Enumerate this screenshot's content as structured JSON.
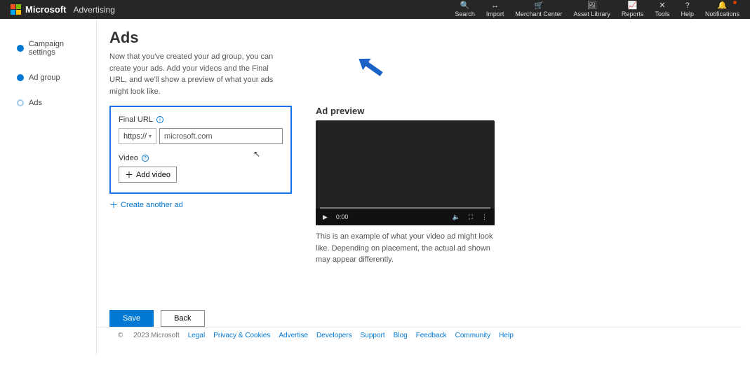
{
  "brand": {
    "name": "Microsoft",
    "product": "Advertising"
  },
  "topnav": [
    {
      "label": "Search",
      "icon": "🔍"
    },
    {
      "label": "Import",
      "icon": "↔"
    },
    {
      "label": "Merchant Center",
      "icon": "🛒"
    },
    {
      "label": "Asset Library",
      "icon": "🖼"
    },
    {
      "label": "Reports",
      "icon": "📈"
    },
    {
      "label": "Tools",
      "icon": "✕"
    },
    {
      "label": "Help",
      "icon": "?"
    },
    {
      "label": "Notifications",
      "icon": "🔔",
      "dot": true
    }
  ],
  "steps": [
    {
      "label": "Campaign settings",
      "done": true
    },
    {
      "label": "Ad group",
      "done": true
    },
    {
      "label": "Ads",
      "done": false
    }
  ],
  "page": {
    "title": "Ads",
    "intro": "Now that you've created your ad group, you can create your ads. Add your videos and the Final URL, and we'll show a preview of what your ads might look like."
  },
  "form": {
    "finalUrl": {
      "label": "Final URL",
      "protocol": "https://",
      "value": "microsoft.com"
    },
    "video": {
      "label": "Video",
      "button": "Add video"
    },
    "createAnother": "Create another ad"
  },
  "preview": {
    "title": "Ad preview",
    "time": "0:00",
    "desc": "This is an example of what your video ad might look like. Depending on placement, the actual ad shown may appear differently."
  },
  "actions": {
    "save": "Save",
    "back": "Back"
  },
  "footer": {
    "copyright": "2023 Microsoft",
    "links": [
      "Legal",
      "Privacy & Cookies",
      "Advertise",
      "Developers",
      "Support",
      "Blog",
      "Feedback",
      "Community",
      "Help"
    ]
  }
}
